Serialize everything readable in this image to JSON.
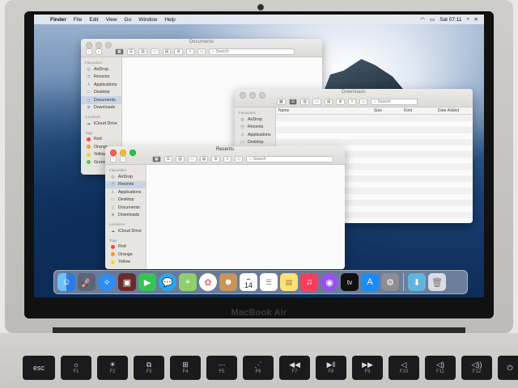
{
  "laptop": {
    "brand": "MacBook Air"
  },
  "menubar": {
    "app_name": "Finder",
    "items": [
      "File",
      "Edit",
      "View",
      "Go",
      "Window",
      "Help"
    ],
    "clock": "Sat 07:11"
  },
  "windows": {
    "documents": {
      "title": "Documents",
      "search_placeholder": "Search",
      "sidebar": {
        "favourites_header": "Favourites",
        "favourites": [
          "AirDrop",
          "Recents",
          "Applications",
          "Desktop",
          "Documents",
          "Downloads"
        ],
        "locations_header": "Locations",
        "locations": [
          "iCloud Drive"
        ],
        "tags_header": "Tags",
        "tags": [
          "Red",
          "Orange",
          "Yellow",
          "Green"
        ]
      }
    },
    "downloads": {
      "title": "Downloads",
      "search_placeholder": "Search",
      "columns": [
        "Name",
        "Size",
        "Kind",
        "Date Added"
      ],
      "sidebar": {
        "favourites_header": "Favourites",
        "favourites": [
          "AirDrop",
          "Recents",
          "Applications",
          "Desktop"
        ]
      }
    },
    "recents": {
      "title": "Recents",
      "search_placeholder": "Search",
      "sidebar": {
        "favourites_header": "Favourites",
        "favourites": [
          "AirDrop",
          "Recents",
          "Applications",
          "Desktop",
          "Documents",
          "Downloads"
        ],
        "locations_header": "Locations",
        "locations": [
          "iCloud Drive"
        ],
        "tags_header": "Tags",
        "tags": [
          "Red",
          "Orange",
          "Yellow"
        ]
      }
    }
  },
  "tag_colors": {
    "Red": "#f0483e",
    "Orange": "#f79a2b",
    "Yellow": "#f5cf32",
    "Green": "#58c248"
  },
  "dock": {
    "apps": [
      {
        "name": "Finder",
        "icon": "finder-icon",
        "color": "#3b8df0"
      },
      {
        "name": "Launchpad",
        "icon": "launchpad-icon",
        "color": "#5a6678"
      },
      {
        "name": "Safari",
        "icon": "safari-icon",
        "color": "#2d8ef5"
      },
      {
        "name": "Photo Booth",
        "icon": "photobooth-icon",
        "color": "#6d2a2a"
      },
      {
        "name": "FaceTime",
        "icon": "facetime-icon",
        "color": "#35c553"
      },
      {
        "name": "Messages",
        "icon": "messages-icon",
        "color": "#27a8f4"
      },
      {
        "name": "Maps",
        "icon": "maps-icon",
        "color": "#8fcf6c"
      },
      {
        "name": "Photos",
        "icon": "photos-icon",
        "color": "#ffffff"
      },
      {
        "name": "Contacts",
        "icon": "contacts-icon",
        "color": "#c8955a"
      },
      {
        "name": "Calendar",
        "icon": "calendar-icon",
        "color": "#ffffff",
        "day": "14"
      },
      {
        "name": "Reminders",
        "icon": "reminders-icon",
        "color": "#ffffff"
      },
      {
        "name": "Notes",
        "icon": "notes-icon",
        "color": "#fbe27a"
      },
      {
        "name": "Music",
        "icon": "music-icon",
        "color": "#fb3d5c"
      },
      {
        "name": "Podcasts",
        "icon": "podcasts-icon",
        "color": "#9b4ff0"
      },
      {
        "name": "TV",
        "icon": "tv-icon",
        "color": "#111111",
        "label": "tv"
      },
      {
        "name": "App Store",
        "icon": "appstore-icon",
        "color": "#1b8cf5"
      },
      {
        "name": "System Preferences",
        "icon": "gear-icon",
        "color": "#8d8d92"
      },
      {
        "name": "Downloads Stack",
        "icon": "downloads-folder-icon",
        "color": "#5fb5e0"
      },
      {
        "name": "Trash",
        "icon": "trash-icon",
        "color": "#d9dde2"
      }
    ]
  },
  "keyboard": {
    "keys": [
      {
        "glyph": "esc",
        "label": ""
      },
      {
        "glyph": "☼",
        "label": "F1"
      },
      {
        "glyph": "☀",
        "label": "F2"
      },
      {
        "glyph": "⧉",
        "label": "F3"
      },
      {
        "glyph": "⊞",
        "label": "F4"
      },
      {
        "glyph": "⋯",
        "label": "F5"
      },
      {
        "glyph": "⋰",
        "label": "F6"
      },
      {
        "glyph": "◀◀",
        "label": "F7"
      },
      {
        "glyph": "▶‖",
        "label": "F8"
      },
      {
        "glyph": "▶▶",
        "label": "F9"
      },
      {
        "glyph": "◁",
        "label": "F10"
      },
      {
        "glyph": "◁)",
        "label": "F11"
      },
      {
        "glyph": "◁))",
        "label": "F12"
      },
      {
        "glyph": "⏻",
        "label": ""
      }
    ]
  }
}
